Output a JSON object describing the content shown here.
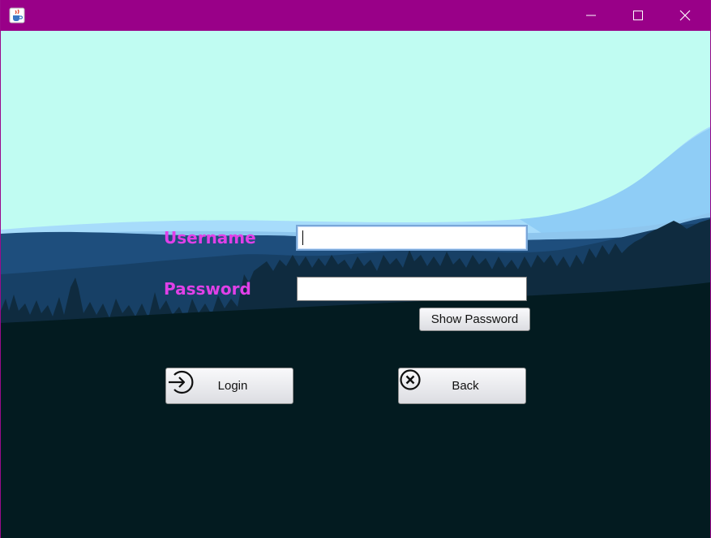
{
  "window": {
    "title": ""
  },
  "form": {
    "username_label": "Username",
    "username_value": "",
    "password_label": "Password",
    "password_value": ""
  },
  "buttons": {
    "show_password": "Show Password",
    "login": "Login",
    "back": "Back"
  },
  "icons": {
    "app": "java-cup-icon",
    "minimize": "minimize-icon",
    "maximize": "maximize-icon",
    "close": "close-icon",
    "login": "login-arrow-icon",
    "back": "close-circle-icon"
  },
  "colors": {
    "titlebar": "#990088",
    "label": "#e040e8",
    "sky": "#c0fcf2",
    "ground": "#031b20"
  }
}
